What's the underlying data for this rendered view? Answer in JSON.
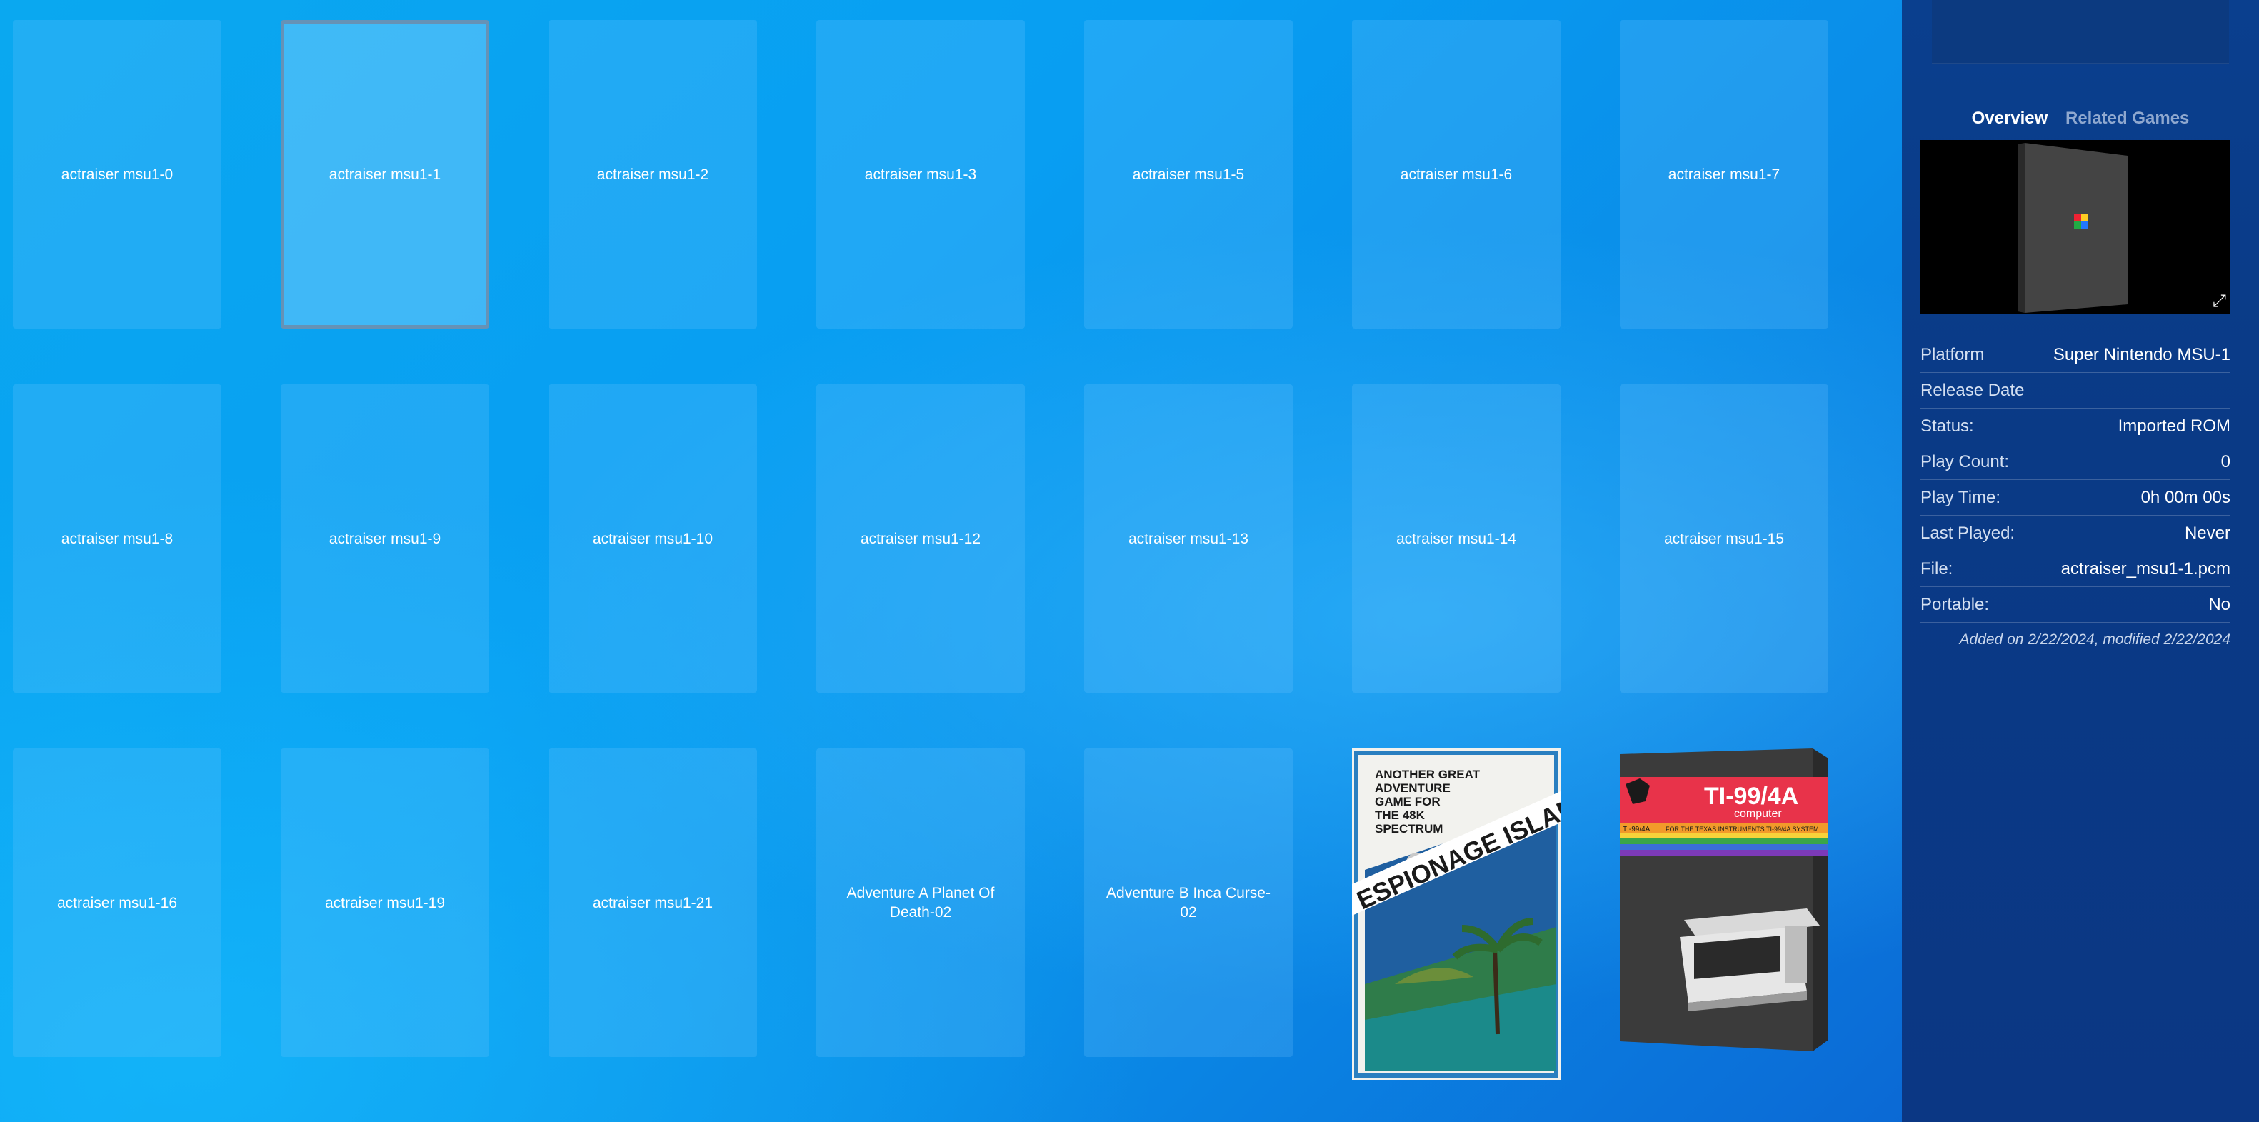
{
  "tiles": [
    {
      "label": "actraiser msu1-0"
    },
    {
      "label": "actraiser msu1-1",
      "selected": true
    },
    {
      "label": "actraiser msu1-2"
    },
    {
      "label": "actraiser msu1-3"
    },
    {
      "label": "actraiser msu1-5"
    },
    {
      "label": "actraiser msu1-6"
    },
    {
      "label": "actraiser msu1-7"
    },
    {
      "label": "actraiser msu1-8"
    },
    {
      "label": "actraiser msu1-9"
    },
    {
      "label": "actraiser msu1-10"
    },
    {
      "label": "actraiser msu1-12"
    },
    {
      "label": "actraiser msu1-13"
    },
    {
      "label": "actraiser msu1-14"
    },
    {
      "label": "actraiser msu1-15"
    },
    {
      "label": "actraiser msu1-16"
    },
    {
      "label": "actraiser msu1-19"
    },
    {
      "label": "actraiser msu1-21"
    },
    {
      "label": "Adventure A Planet Of Death-02"
    },
    {
      "label": "Adventure B Inca Curse-02"
    },
    {
      "cover": "espionage"
    },
    {
      "cover": "ti99"
    }
  ],
  "covers": {
    "espionage": {
      "tagline": [
        "ANOTHER GREAT",
        "ADVENTURE",
        "GAME FOR",
        "THE 48K",
        "SPECTRUM"
      ],
      "title": "ESPIONAGE ISLAND"
    },
    "ti99": {
      "logo": "TI-99/4A",
      "sub": "computer",
      "stripe": "FOR THE TEXAS INSTRUMENTS TI-99/4A SYSTEM",
      "small": "TI-99/4A"
    }
  },
  "panel": {
    "tabs": [
      {
        "label": "Overview",
        "active": true
      },
      {
        "label": "Related Games",
        "active": false
      }
    ],
    "expand_icon": "expand-icon",
    "fields": [
      {
        "key": "Platform",
        "value": "Super Nintendo MSU-1"
      },
      {
        "key": "Release Date",
        "value": ""
      },
      {
        "key": "Status:",
        "value": "Imported ROM"
      },
      {
        "key": "Play Count:",
        "value": "0"
      },
      {
        "key": "Play Time:",
        "value": "0h 00m 00s"
      },
      {
        "key": "Last Played:",
        "value": "Never"
      },
      {
        "key": "File:",
        "value": "actraiser_msu1-1.pcm"
      },
      {
        "key": "Portable:",
        "value": "No"
      }
    ],
    "added": "Added on 2/22/2024, modified 2/22/2024"
  }
}
